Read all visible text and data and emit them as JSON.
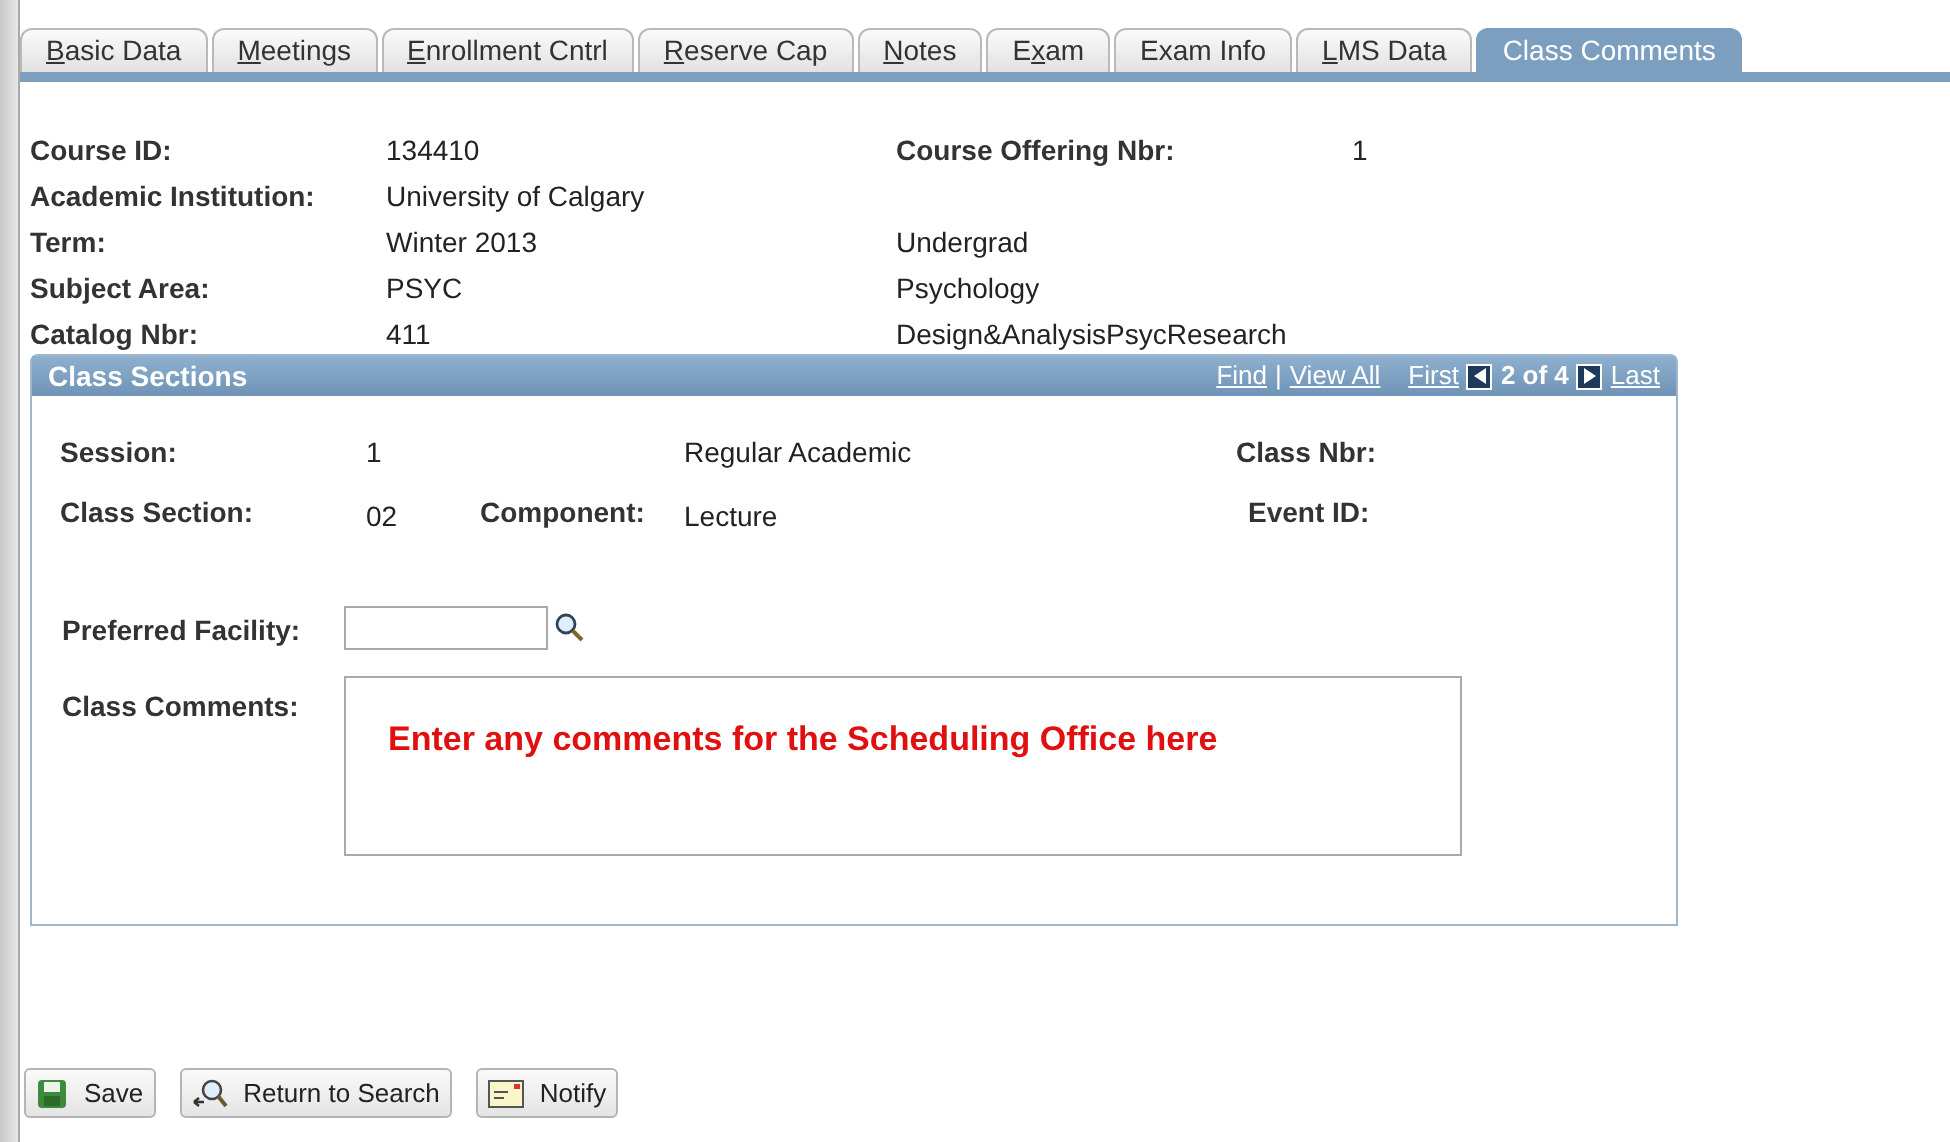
{
  "tabs": [
    {
      "key": "B",
      "post": "asic Data",
      "selected": false
    },
    {
      "key": "M",
      "post": "eetings",
      "selected": false
    },
    {
      "key": "E",
      "post": "nrollment Cntrl",
      "selected": false
    },
    {
      "key": "R",
      "post": "eserve Cap",
      "selected": false
    },
    {
      "key": "N",
      "post": "otes",
      "selected": false
    },
    {
      "pre": "E",
      "key": "x",
      "post": "am",
      "selected": false
    },
    {
      "pre": "Exam Info",
      "selected": false
    },
    {
      "key": "L",
      "post": "MS Data",
      "selected": false
    },
    {
      "pre": "Class Comments",
      "selected": true
    }
  ],
  "course": {
    "course_id": {
      "label": "Course ID:",
      "value": "134410"
    },
    "offering": {
      "label": "Course Offering Nbr:",
      "value": "1"
    },
    "institution": {
      "label": "Academic Institution:",
      "value": "University of Calgary"
    },
    "term": {
      "label": "Term:",
      "value": "Winter 2013",
      "extra": "Undergrad"
    },
    "subject": {
      "label": "Subject Area:",
      "value": "PSYC",
      "extra": "Psychology"
    },
    "catalog": {
      "label": "Catalog Nbr:",
      "value": "411",
      "extra": "Design&AnalysisPsycResearch"
    }
  },
  "class_sections": {
    "title": "Class Sections",
    "nav": {
      "find": "Find",
      "separator": "|",
      "view_all": "View All",
      "first": "First",
      "position": "2 of 4",
      "last": "Last"
    },
    "session": {
      "label": "Session:",
      "value": "1",
      "desc": "Regular Academic"
    },
    "class_nbr": {
      "label": "Class Nbr:"
    },
    "class_section": {
      "label": "Class Section:",
      "value": "02"
    },
    "component": {
      "label": "Component:",
      "value": "Lecture"
    },
    "event_id": {
      "label": "Event ID:"
    },
    "preferred_facility": {
      "label": "Preferred Facility:"
    },
    "class_comments": {
      "label": "Class Comments:",
      "value": "Enter any comments for the Scheduling Office here"
    }
  },
  "buttons": [
    {
      "kind": "save",
      "label": "Save"
    },
    {
      "kind": "search",
      "label": "Return to Search"
    },
    {
      "kind": "notify",
      "label": "Notify"
    }
  ]
}
